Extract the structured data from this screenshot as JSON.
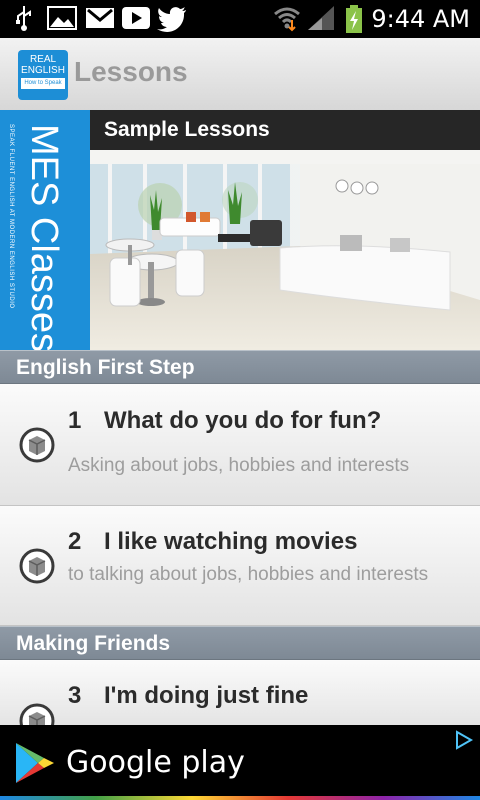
{
  "status_bar": {
    "time": "9:44 AM",
    "left_icons": [
      "usb-icon",
      "gallery-icon",
      "gmail-icon",
      "youtube-icon",
      "twitter-icon"
    ],
    "right_icons": [
      "wifi-icon",
      "signal-icon",
      "battery-charging-icon"
    ]
  },
  "action_bar": {
    "logo": {
      "line1": "REAL",
      "line2": "ENGLISH",
      "line3": "How to Speak"
    },
    "title": "Lessons"
  },
  "banner": {
    "side_title": "MES Classes",
    "side_subtitle": "SPEAK FLUENT ENGLISH AT MODERN ENGLISH STUDIO",
    "header": "Sample Lessons"
  },
  "sections": [
    {
      "title": "English First Step",
      "lessons": [
        {
          "number": "1",
          "title": "What do you do for fun?",
          "description": "Asking about jobs, hobbies and interests"
        },
        {
          "number": "2",
          "title": "I like watching movies",
          "description": "to talking about jobs, hobbies and interests"
        }
      ]
    },
    {
      "title": "Making Friends",
      "lessons": [
        {
          "number": "3",
          "title": "I'm doing just fine",
          "description": ""
        }
      ]
    }
  ],
  "ad": {
    "text": "Google play"
  },
  "colors": {
    "accent": "#1d8fd8",
    "section_header": "#8793a0",
    "status_bar": "#000000"
  }
}
